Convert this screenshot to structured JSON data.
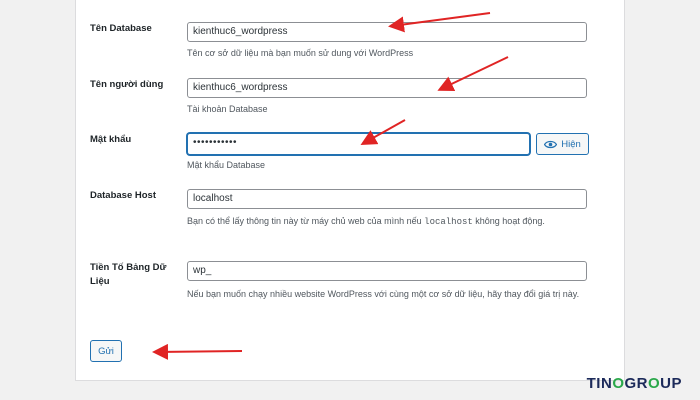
{
  "form": {
    "db_name": {
      "label": "Tên Database",
      "value": "kienthuc6_wordpress",
      "desc": "Tên cơ sở dữ liệu mà bạn muốn sử dung với WordPress"
    },
    "username": {
      "label": "Tên người dùng",
      "value": "kienthuc6_wordpress",
      "desc": "Tài khoản Database"
    },
    "password": {
      "label": "Mật khẩu",
      "value": "•••••••••••",
      "show_label": "Hiện",
      "desc": "Mật khẩu Database"
    },
    "db_host": {
      "label": "Database Host",
      "value": "localhost",
      "desc_before": "Bạn có thể lấy thông tin này từ máy chủ web của mình nếu ",
      "desc_code": "localhost",
      "desc_after": " không hoạt động."
    },
    "prefix": {
      "label": "Tiền Tố Bảng Dữ Liệu",
      "value": "wp_",
      "desc": "Nếu bạn muốn chạy nhiều website WordPress với cùng một cơ sở dữ liệu, hãy thay đổi giá trị này."
    },
    "submit_label": "Gửi"
  },
  "annotation_color": "#e02424",
  "logo": {
    "part1": "TIN",
    "o": "O",
    "part2": "GR",
    "o2": "O",
    "part3": "UP"
  }
}
